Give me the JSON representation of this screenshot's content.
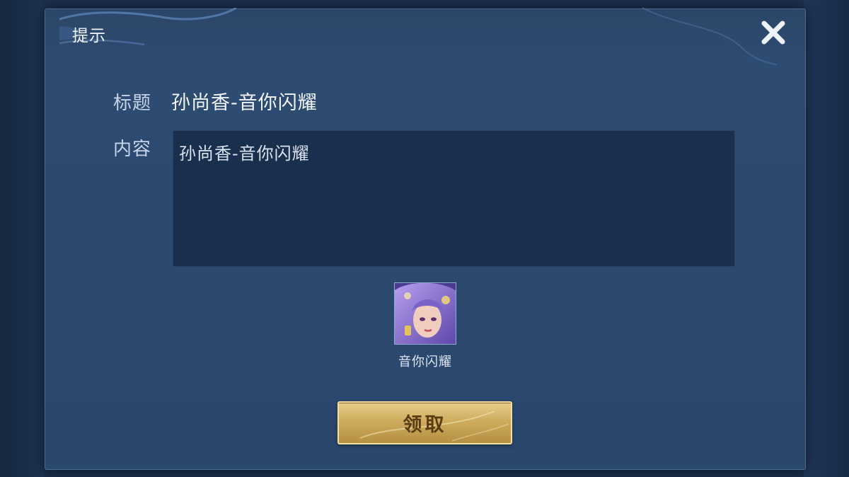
{
  "dialog": {
    "title": "提示",
    "close_icon": "close-x-icon"
  },
  "mail": {
    "title_label": "标题",
    "title_value": "孙尚香-音你闪耀",
    "content_label": "内容",
    "content_value": "孙尚香-音你闪耀"
  },
  "reward": {
    "icon": "hero-skin-portrait",
    "name": "音你闪耀"
  },
  "actions": {
    "claim_label": "领取"
  },
  "colors": {
    "panel": "#2c4a70",
    "content_bg": "#1a2f4d",
    "button_gold": "#d4b26a",
    "button_text": "#5a3c12"
  }
}
